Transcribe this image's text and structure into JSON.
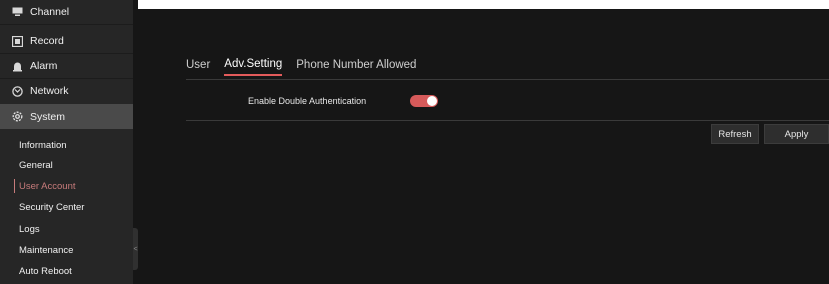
{
  "sidebar": {
    "nav": [
      {
        "label": "Channel",
        "icon": "channel-icon"
      },
      {
        "label": "Record",
        "icon": "record-icon"
      },
      {
        "label": "Alarm",
        "icon": "alarm-icon"
      },
      {
        "label": "Network",
        "icon": "network-icon"
      },
      {
        "label": "System",
        "icon": "gear-icon",
        "active": true
      }
    ],
    "sub_items": [
      {
        "label": "Information"
      },
      {
        "label": "General"
      },
      {
        "label": "User Account",
        "active": true
      },
      {
        "label": "Security Center"
      },
      {
        "label": "Logs"
      },
      {
        "label": "Maintenance"
      },
      {
        "label": "Auto Reboot"
      }
    ],
    "collapse_glyph": "<"
  },
  "main": {
    "tabs": [
      {
        "label": "User"
      },
      {
        "label": "Adv.Setting",
        "active": true
      },
      {
        "label": "Phone Number Allowed"
      }
    ],
    "settings": {
      "double_auth_label": "Enable Double Authentication",
      "double_auth_enabled": true
    },
    "buttons": {
      "refresh": "Refresh",
      "apply": "Apply"
    }
  },
  "colors": {
    "accent": "#d65a5a",
    "active_sub": "#c77b7b",
    "background": "#161616",
    "sidebar": "#262626"
  }
}
